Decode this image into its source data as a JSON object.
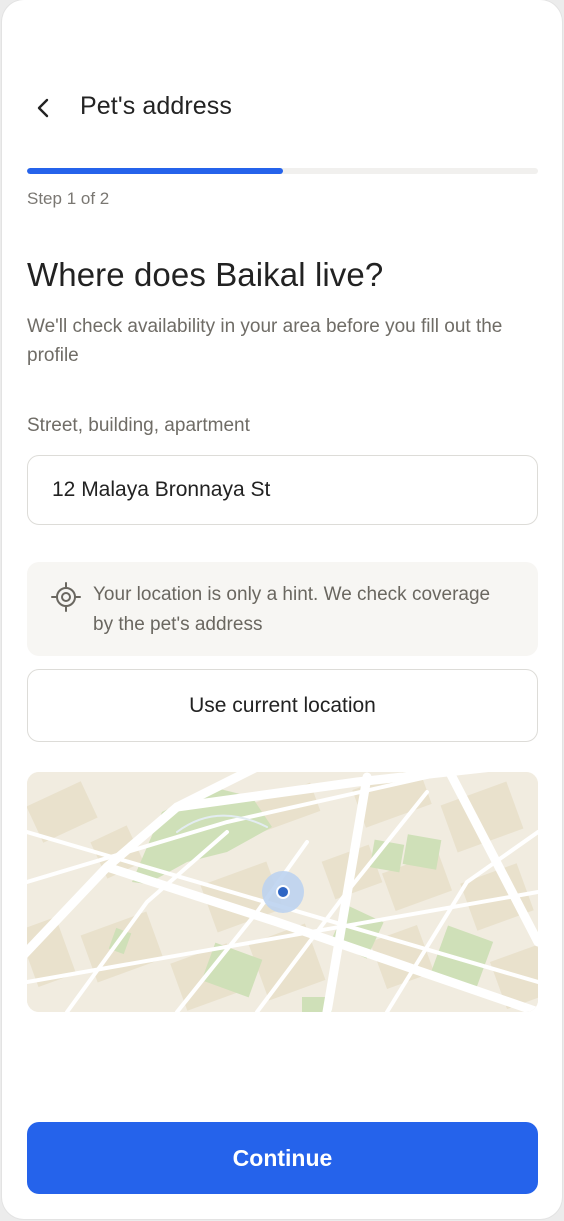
{
  "header": {
    "title": "Pet's address",
    "back_icon": "chevron-left-icon"
  },
  "progress": {
    "step_label": "Step 1 of 2",
    "fraction": 0.5,
    "color": "#2563eb"
  },
  "main": {
    "question": "Where does Baikal live?",
    "subtitle": "We'll check availability in your area before you fill out the profile",
    "address_label": "Street, building, apartment",
    "address_value": "12 Malaya Bronnaya St",
    "hint": {
      "icon": "target-location-icon",
      "text": "Your location is only a hint. We check coverage by the pet's address"
    },
    "use_location_label": "Use current location",
    "map": {
      "marker_icon": "current-location-dot-icon"
    }
  },
  "footer": {
    "continue_label": "Continue"
  },
  "colors": {
    "accent": "#2563eb",
    "park": "#cfe0b8",
    "block": "#eae3d1",
    "road": "#ffffff"
  }
}
